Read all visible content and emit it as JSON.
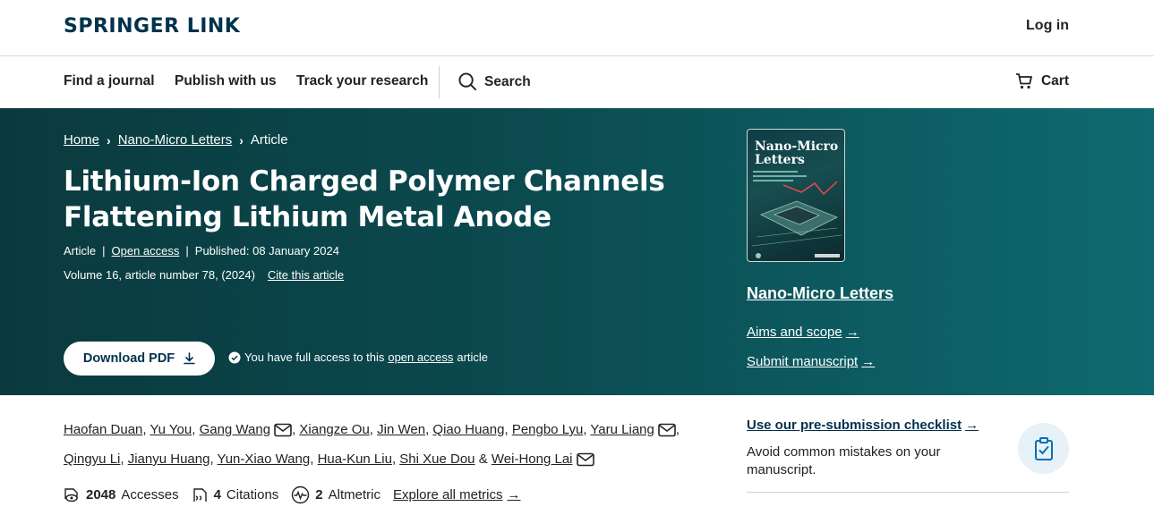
{
  "header": {
    "brand": "SPRINGER LINK",
    "login": "Log in"
  },
  "nav": {
    "find_journal": "Find a journal",
    "publish": "Publish with us",
    "track": "Track your research",
    "search": "Search",
    "cart": "Cart"
  },
  "breadcrumb": {
    "home": "Home",
    "journal": "Nano-Micro Letters",
    "current": "Article"
  },
  "article": {
    "title": "Lithium-Ion Charged Polymer Channels Flattening Lithium Metal Anode",
    "type": "Article",
    "open_access": "Open access",
    "published": "Published: 08 January 2024",
    "volume": "Volume 16, article number 78, (2024)",
    "cite": "Cite this article",
    "download": "Download PDF",
    "access_prefix": "You have full access to this",
    "access_link": "open access",
    "access_suffix": "article"
  },
  "sidebar": {
    "cover_title_1": "Nano-Micro",
    "cover_title_2": "Letters",
    "journal": "Nano-Micro Letters",
    "aims": "Aims and scope",
    "submit": "Submit manuscript",
    "checklist": "Use our pre-submission checklist",
    "checklist_desc": "Avoid common mistakes on your manuscript."
  },
  "authors": {
    "line1": [
      "Haofan Duan",
      "Yu You",
      "Gang Wang",
      "Xiangze Ou",
      "Jin Wen",
      "Qiao Huang",
      "Pengbo Lyu",
      "Yaru Liang"
    ],
    "line2": [
      "Qingyu Li",
      "Jianyu Huang",
      "Yun-Xiao Wang",
      "Hua-Kun Liu",
      "Shi Xue Dou",
      "Wei-Hong Lai"
    ],
    "amp": "&"
  },
  "metrics": {
    "accesses_value": "2048",
    "accesses_label": "Accesses",
    "citations_value": "4",
    "citations_label": "Citations",
    "altmetric_value": "2",
    "altmetric_label": "Altmetric",
    "explore": "Explore all metrics"
  },
  "colors": {
    "brand": "#01324b",
    "hero_start": "#0a3a3e",
    "hero_end": "#0e6a70"
  }
}
